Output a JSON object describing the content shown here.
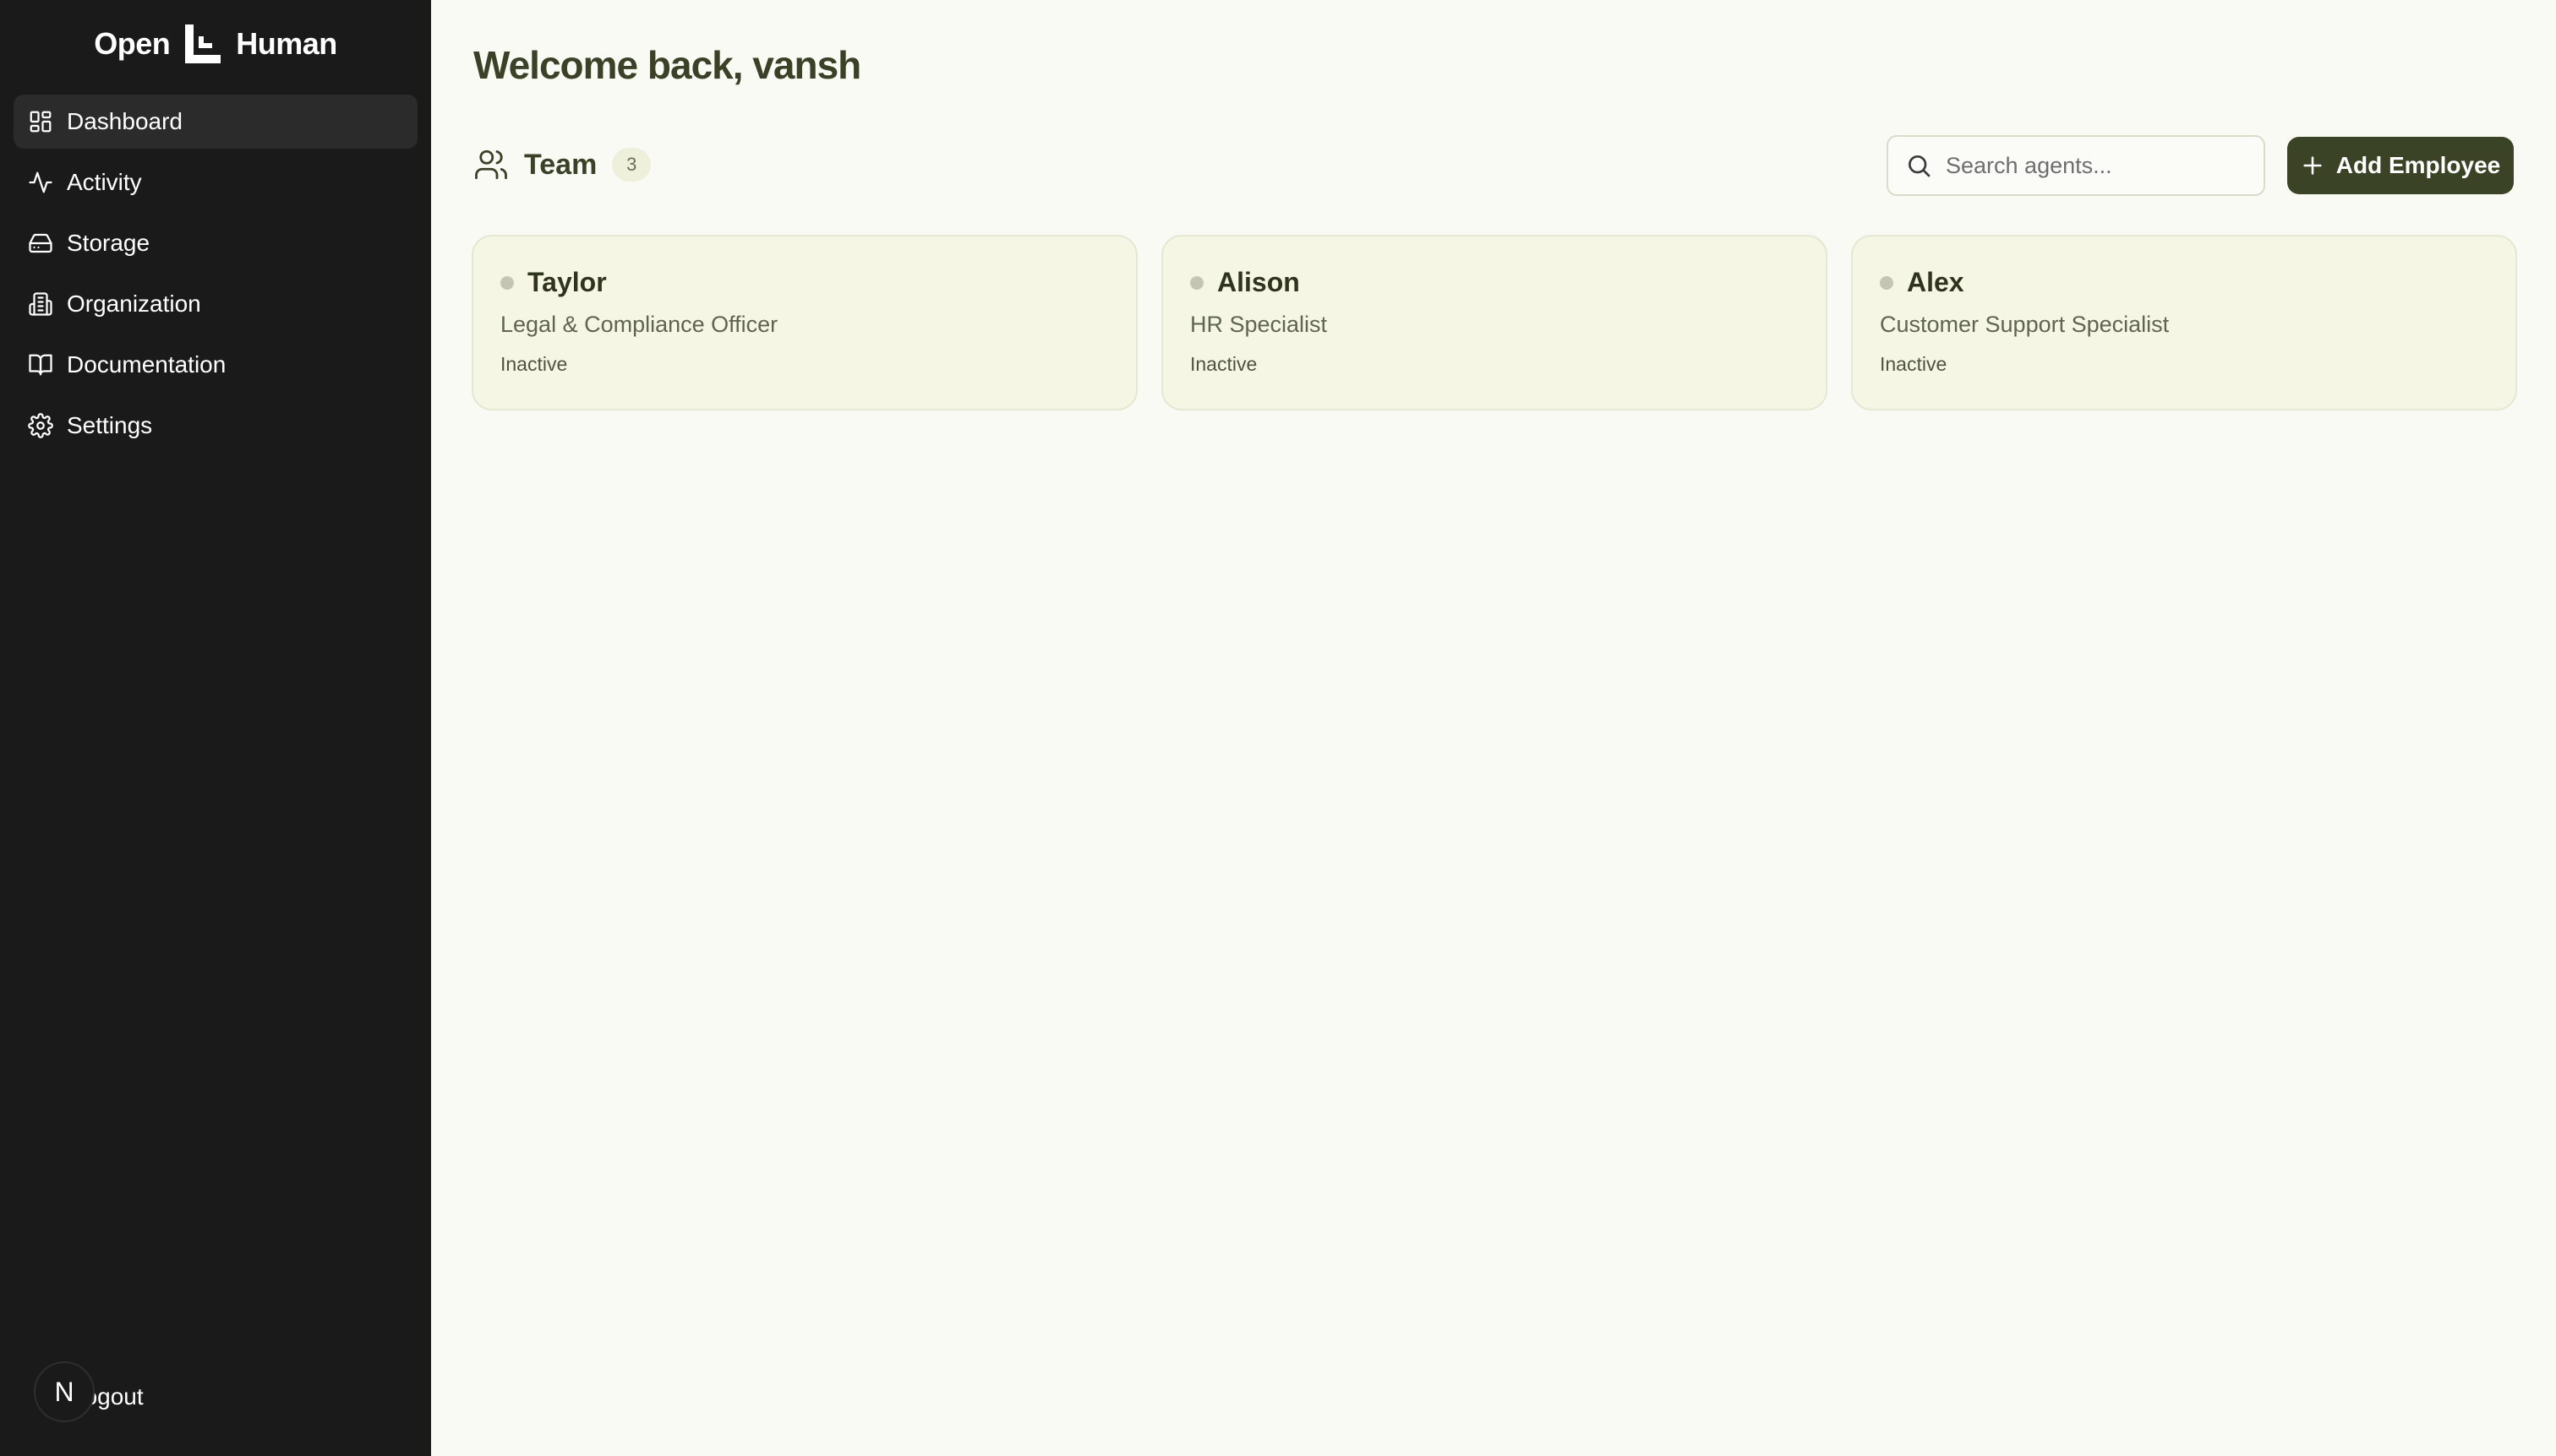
{
  "brand": {
    "left": "Open",
    "right": "Human"
  },
  "sidebar": {
    "items": [
      {
        "label": "Dashboard",
        "icon": "dashboard-grid-icon",
        "active": true
      },
      {
        "label": "Activity",
        "icon": "activity-pulse-icon"
      },
      {
        "label": "Storage",
        "icon": "hard-drive-icon"
      },
      {
        "label": "Organization",
        "icon": "building-icon"
      },
      {
        "label": "Documentation",
        "icon": "book-open-icon"
      },
      {
        "label": "Settings",
        "icon": "gear-icon"
      }
    ],
    "avatar_initial": "N",
    "logout_label": "Logout"
  },
  "main": {
    "title": "Welcome back, vansh",
    "team": {
      "label": "Team",
      "count": "3"
    },
    "search": {
      "placeholder": "Search agents..."
    },
    "add_button_label": "Add Employee",
    "agents": [
      {
        "name": "Taylor",
        "role": "Legal & Compliance Officer",
        "status": "Inactive"
      },
      {
        "name": "Alison",
        "role": "HR Specialist",
        "status": "Inactive"
      },
      {
        "name": "Alex",
        "role": "Customer Support Specialist",
        "status": "Inactive"
      }
    ]
  },
  "colors": {
    "sidebar_bg": "#1b1a1a",
    "main_bg": "#f9faf4",
    "accent": "#3b4326",
    "card_bg": "#f5f6e4",
    "inactive_dot": "#c4c6b3"
  }
}
